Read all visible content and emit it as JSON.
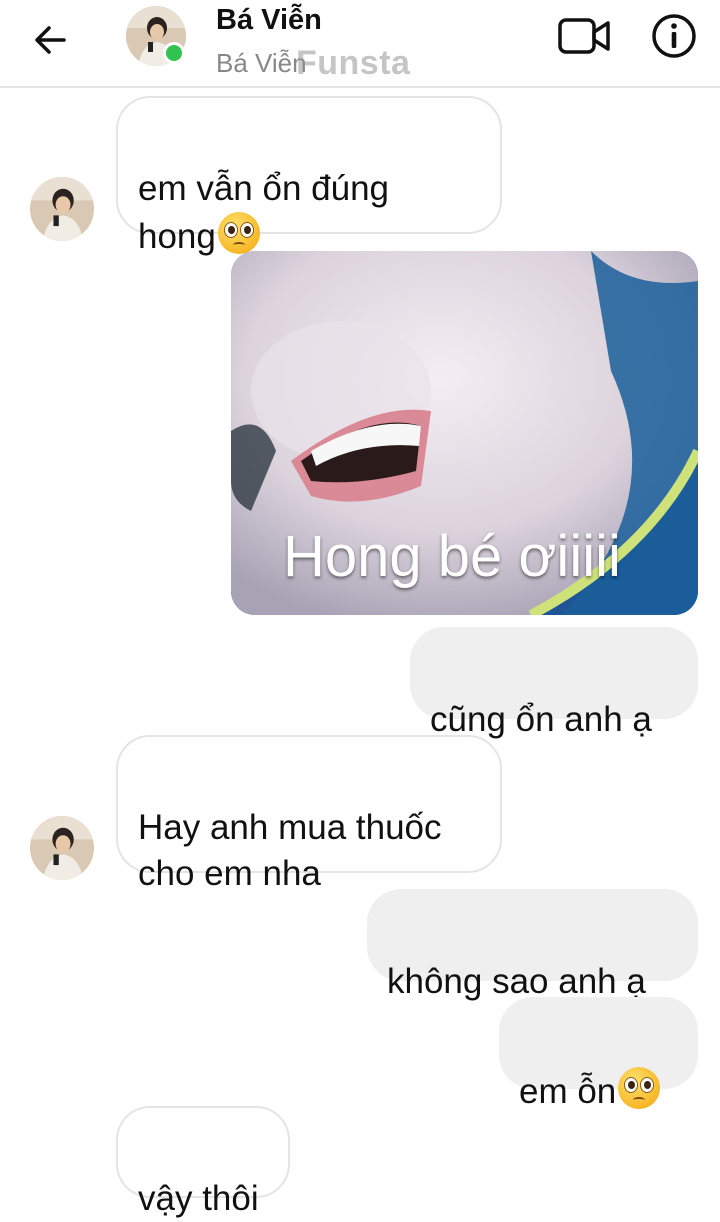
{
  "header": {
    "name": "Bá Viễn",
    "subtitle": "Bá Viễn",
    "watermark": "Funsta",
    "icons": [
      "back-arrow-icon",
      "video-call-icon",
      "info-icon"
    ],
    "online_color": "#31c24f"
  },
  "messages": [
    {
      "side": "in",
      "text": "em vẫn ổn đúng\nhong",
      "emoji": "pleading-face"
    },
    {
      "side": "out",
      "type": "image",
      "caption": "Hong bé ơiiiii"
    },
    {
      "side": "out",
      "text": "cũng ổn anh ạ"
    },
    {
      "side": "in",
      "text": "Hay anh mua thuốc\ncho em nha"
    },
    {
      "side": "out",
      "text": "không sao anh ạ"
    },
    {
      "side": "out",
      "text": "em ỗn",
      "emoji": "pleading-face"
    },
    {
      "side": "in",
      "text": "vậy thôi"
    }
  ]
}
